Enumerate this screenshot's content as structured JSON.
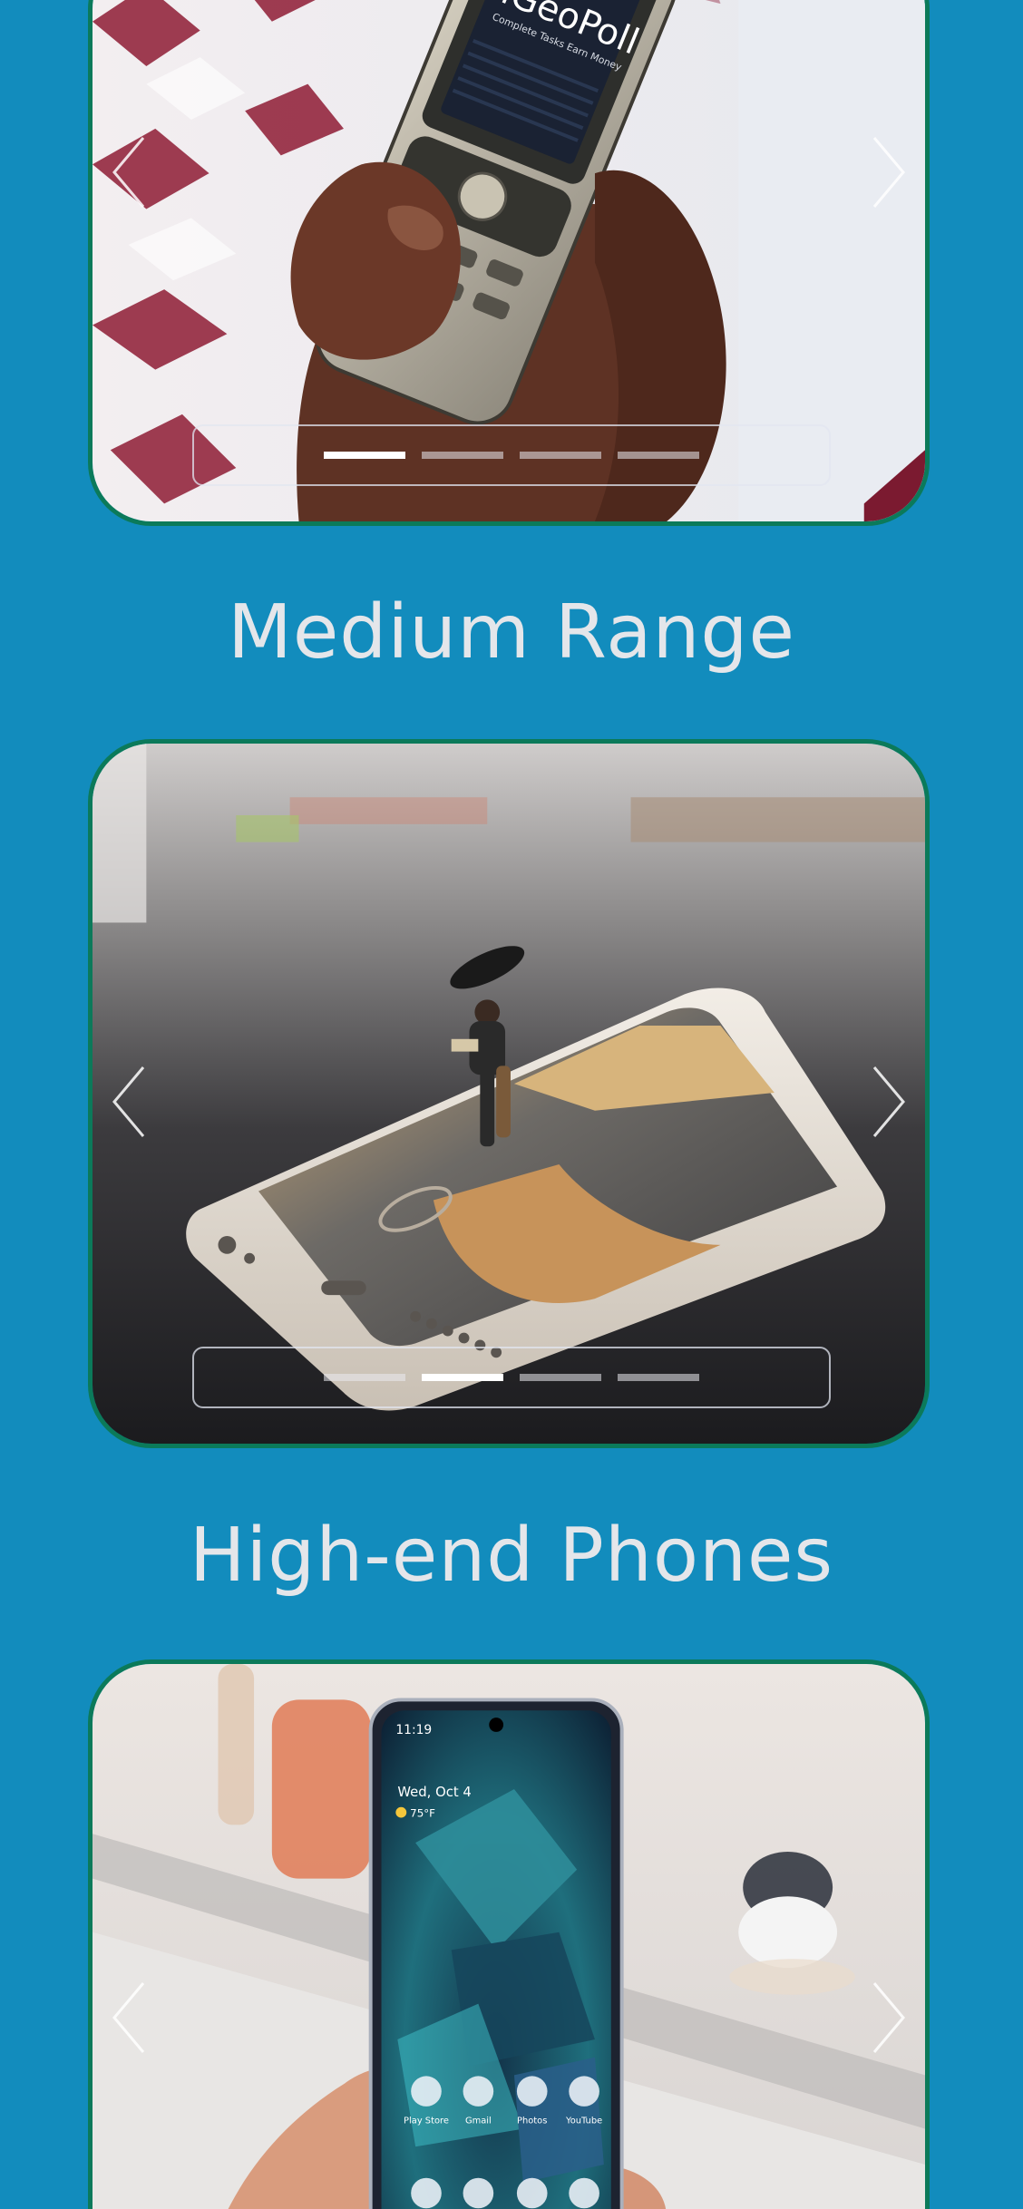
{
  "sections": [
    {
      "title": "",
      "image_text": {
        "brand": "iGeoPoll",
        "tagline": "Complete Tasks Earn Money"
      },
      "slide_count": 4,
      "active_slide": 1
    },
    {
      "title": "Medium Range",
      "slide_count": 4,
      "active_slide": 2
    },
    {
      "title": "High-end Phones",
      "phone_screen": {
        "time": "11:19",
        "date": "Wed, Oct 4",
        "weather": "75°F",
        "apps": [
          "Play Store",
          "Gmail",
          "Photos",
          "YouTube"
        ]
      },
      "slide_count": 4,
      "active_slide": 1
    }
  ],
  "icons": {
    "prev": "chevron-left-icon",
    "next": "chevron-right-icon"
  },
  "colors": {
    "background": "#128cbd",
    "title_text": "#e4e6ea",
    "card_border": "#0b7a5a",
    "indicator_active": "#ffffff"
  }
}
